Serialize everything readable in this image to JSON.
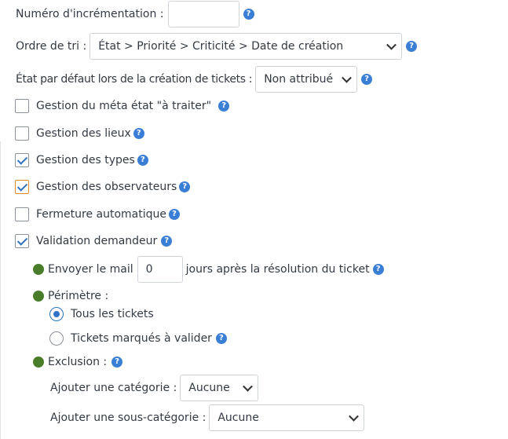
{
  "increment": {
    "label": "Numéro d'incrémentation :",
    "value": ""
  },
  "sort_order": {
    "label": "Ordre de tri :",
    "selected": "État > Priorité > Criticité > Date de création"
  },
  "default_state": {
    "label": "État par défaut lors de la création de tickets :",
    "selected": "Non attribué"
  },
  "options": [
    {
      "label": "Gestion du méta état \"à traiter\"",
      "checked": false
    },
    {
      "label": "Gestion des lieux",
      "checked": false
    },
    {
      "label": "Gestion des types",
      "checked": true
    },
    {
      "label": "Gestion des observateurs",
      "checked": true
    },
    {
      "label": "Fermeture automatique",
      "checked": false
    },
    {
      "label": "Validation demandeur",
      "checked": true
    }
  ],
  "validation": {
    "send_mail_prefix": "Envoyer le mail",
    "send_mail_days": "0",
    "send_mail_suffix": "jours après la résolution du ticket",
    "perimeter_label": "Périmètre :",
    "perimeter_options": [
      "Tous les tickets",
      "Tickets marqués à valider"
    ],
    "perimeter_selected": 0,
    "exclusion_label": "Exclusion :",
    "add_category_label": "Ajouter une catégorie :",
    "add_category_selected": "Aucune",
    "add_subcategory_label": "Ajouter une sous-catégorie :",
    "add_subcategory_selected": "Aucune"
  },
  "help_glyph": "?",
  "colors": {
    "help_icon": "#3a7fd5",
    "bullet": "#4a7d2a",
    "check": "#3273c0",
    "focus": "#e28a2f"
  }
}
